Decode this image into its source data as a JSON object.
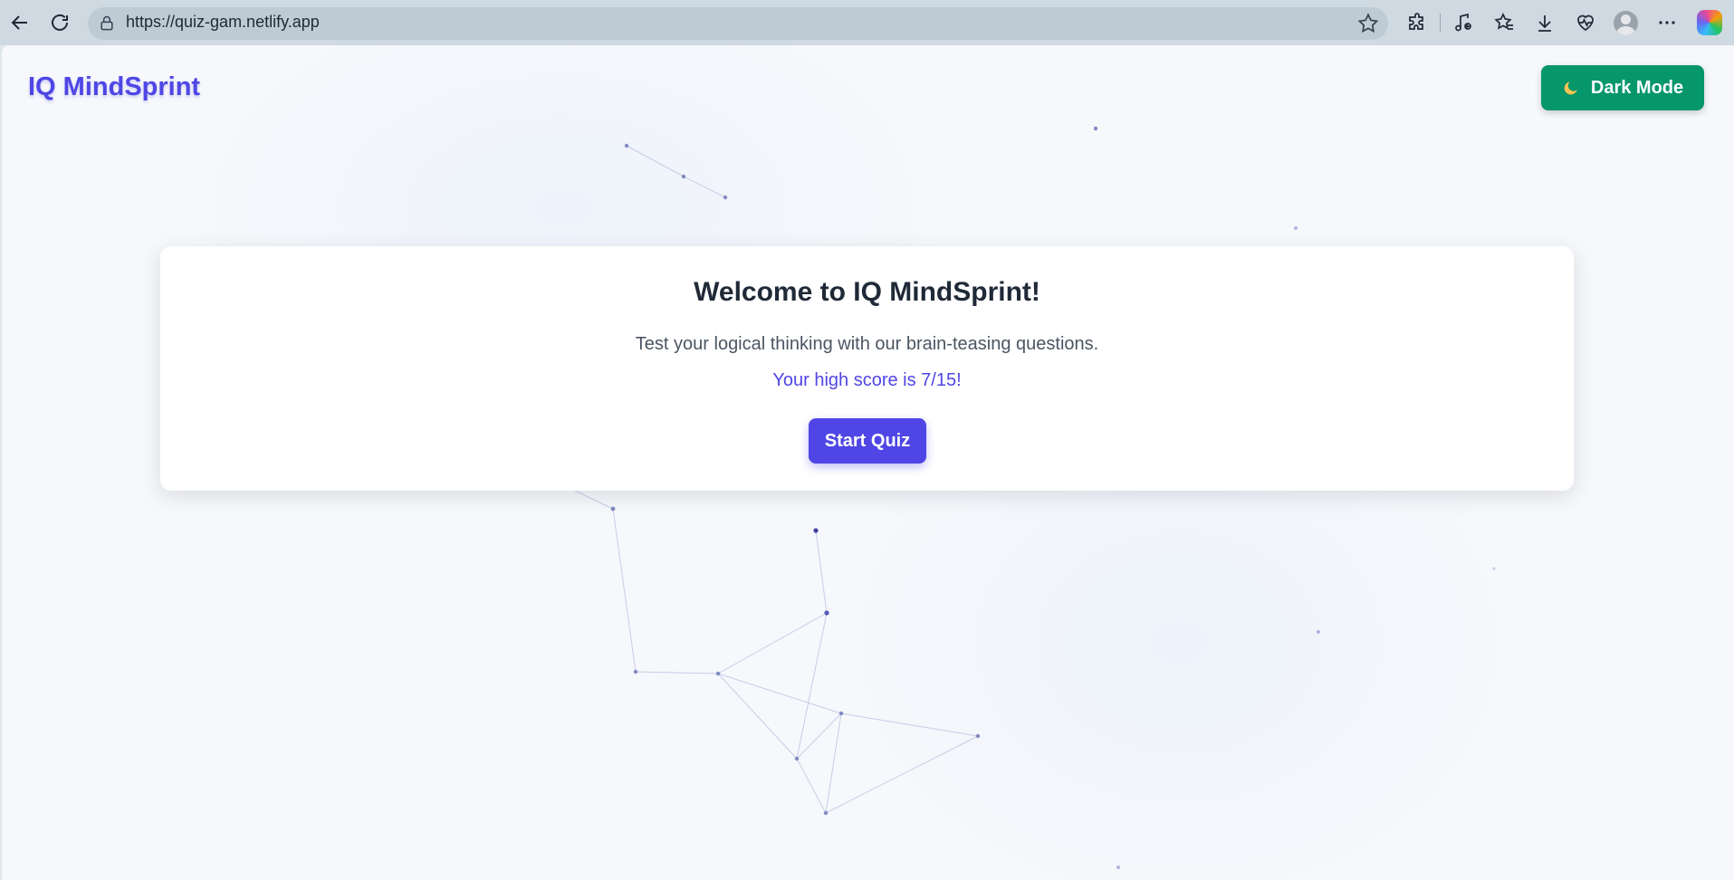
{
  "browser": {
    "url": "https://quiz-gam.netlify.app"
  },
  "app": {
    "brand": "IQ MindSprint",
    "dark_mode_label": "Dark Mode",
    "dark_mode_icon": "moon-icon"
  },
  "welcome": {
    "title": "Welcome to IQ MindSprint!",
    "subtitle": "Test your logical thinking with our brain-teasing questions.",
    "high_score_text": "Your high score is 7/15!",
    "start_label": "Start Quiz"
  },
  "colors": {
    "brand": "#4f46e5",
    "dark_mode_button": "#059669",
    "title_text": "#1f2937"
  }
}
